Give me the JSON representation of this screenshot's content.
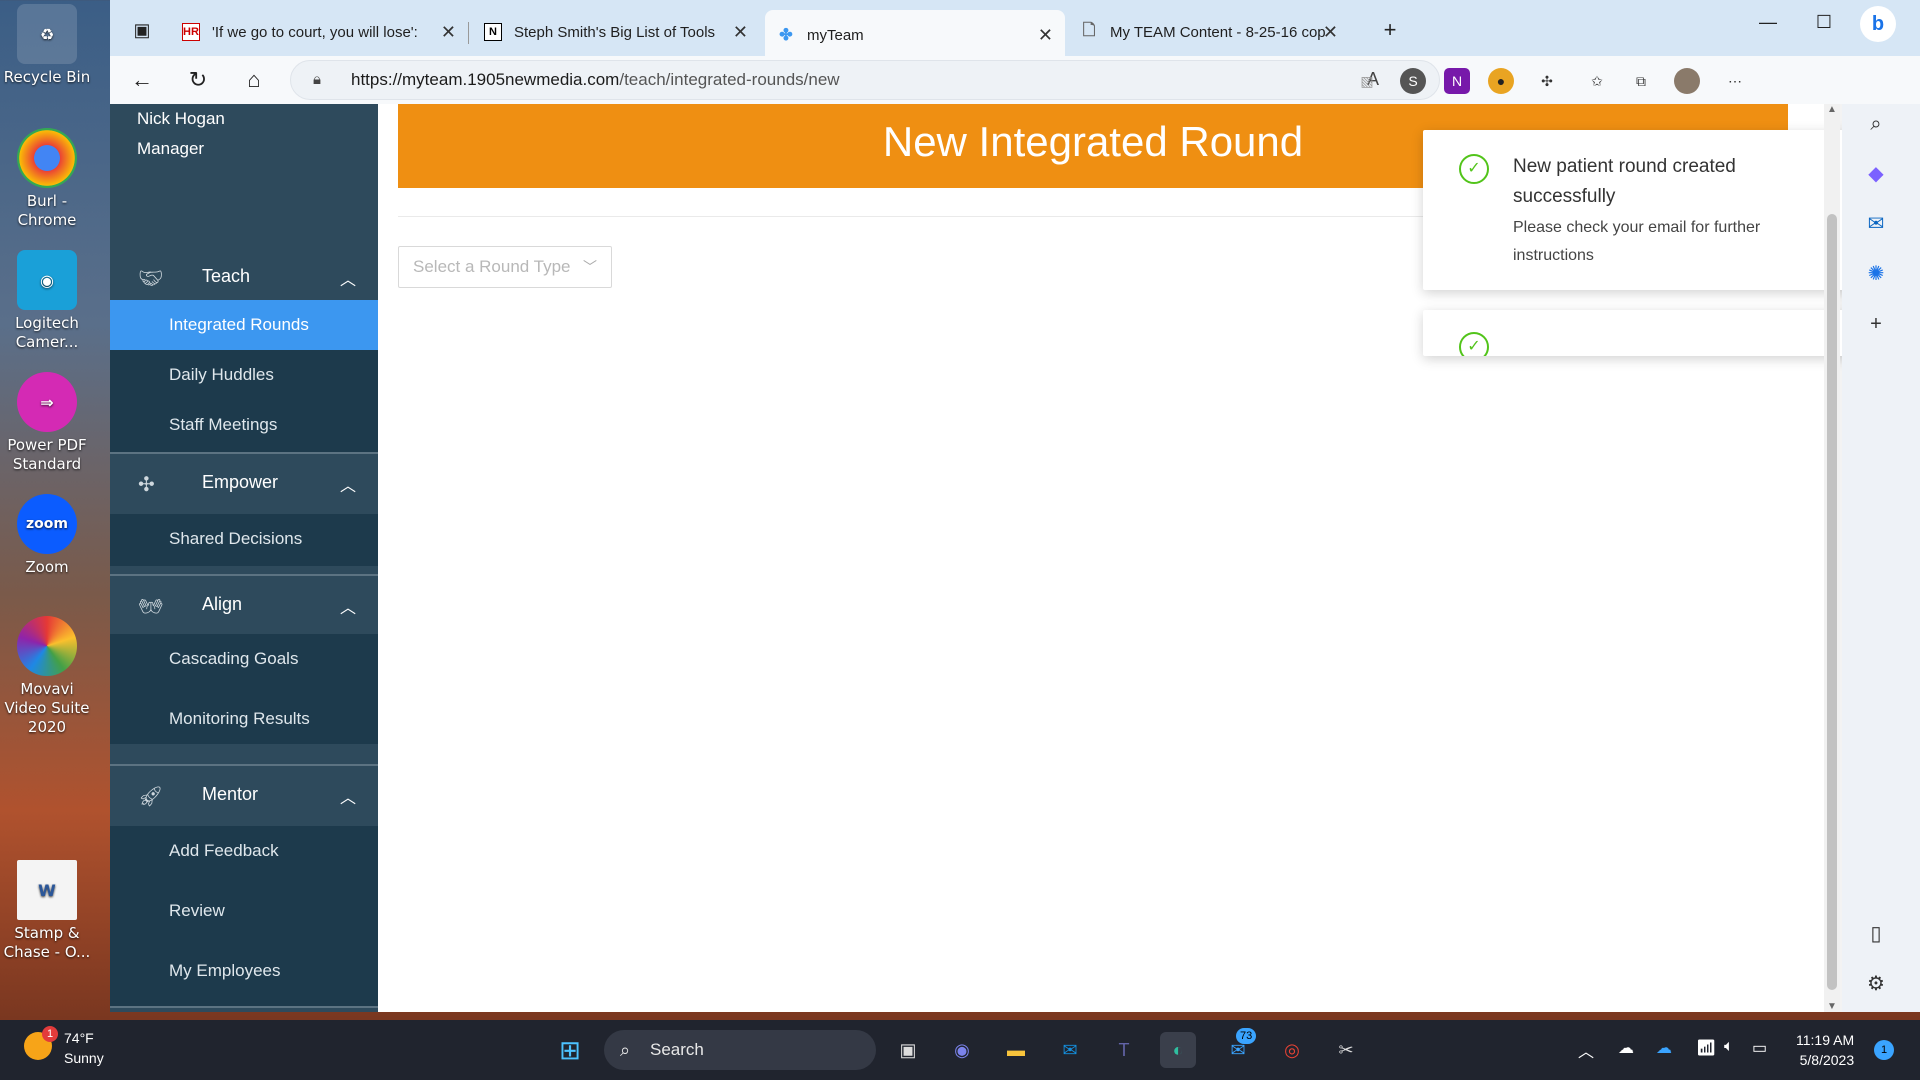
{
  "desktop": {
    "icons": [
      {
        "label": "Recycle Bin"
      },
      {
        "label": "Burl - Chrome"
      },
      {
        "label": "Logitech Camer..."
      },
      {
        "label": "Power PDF Standard"
      },
      {
        "label": "Zoom"
      },
      {
        "label": "Movavi Video Suite 2020"
      },
      {
        "label": "Stamp & Chase - O..."
      }
    ]
  },
  "browser": {
    "tabs": [
      {
        "title": "'If we go to court, you will lose':",
        "icon": "hr-favicon"
      },
      {
        "title": "Steph Smith's Big List of Tools",
        "icon": "notion-favicon"
      },
      {
        "title": "myTeam",
        "icon": "myteam-favicon"
      },
      {
        "title": "My TEAM Content - 8-25-16 cop",
        "icon": "document-favicon"
      }
    ],
    "url_host": "https://myteam.1905newmedia.com",
    "url_path": "/teach/integrated-rounds/new"
  },
  "sidebar": {
    "user_name": "Nick Hogan",
    "user_role": "Manager",
    "sections": [
      {
        "label": "Teach",
        "items": [
          "Integrated Rounds",
          "Daily Huddles",
          "Staff Meetings"
        ]
      },
      {
        "label": "Empower",
        "items": [
          "Shared Decisions"
        ]
      },
      {
        "label": "Align",
        "items": [
          "Cascading Goals",
          "Monitoring Results"
        ]
      },
      {
        "label": "Mentor",
        "items": [
          "Add Feedback",
          "Review",
          "My Employees"
        ]
      }
    ],
    "active_item": "Integrated Rounds"
  },
  "main": {
    "page_title": "New Integrated Round",
    "round_type_placeholder": "Select a Round Type"
  },
  "toasts": [
    {
      "title": "New patient round created successfully",
      "description": "Please check your email for further instructions"
    }
  ],
  "taskbar": {
    "weather_temp": "74°F",
    "weather_desc": "Sunny",
    "weather_badge": "1",
    "search_label": "Search",
    "mail_badge": "73",
    "time": "11:19 AM",
    "date": "5/8/2023",
    "notification_count": "1"
  },
  "colors": {
    "banner": "#ef8f12",
    "sidebar": "#2e4a5c",
    "active_item": "#3c97f0",
    "success": "#52c41a"
  }
}
